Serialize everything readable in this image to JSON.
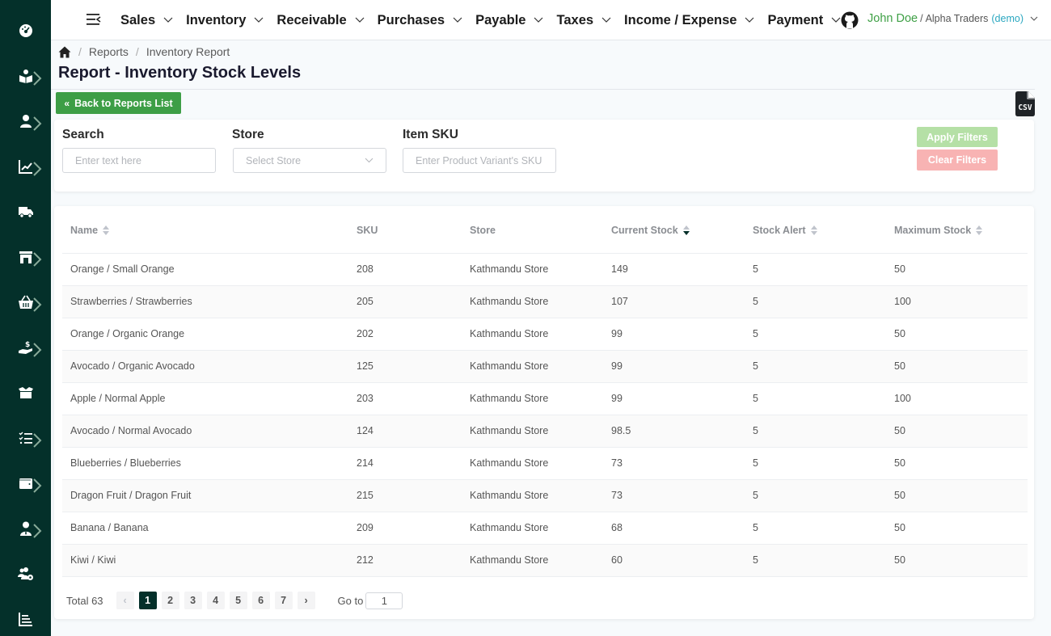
{
  "colors": {
    "sidebar_bg": "#04302a",
    "primary_green": "#3d9e46",
    "apply_disabled": "#b5e0a6",
    "clear_disabled": "#f8b3b3",
    "active_page": "#04302a",
    "user_name": "#3fa046",
    "demo_tag": "#2aa7c0"
  },
  "sidebar": {
    "items": [
      {
        "icon": "dashboard-icon",
        "has_submenu": false
      },
      {
        "icon": "reader-icon",
        "has_submenu": true
      },
      {
        "icon": "user-icon",
        "has_submenu": true
      },
      {
        "icon": "chart-line-icon",
        "has_submenu": true
      },
      {
        "icon": "truck-icon",
        "has_submenu": false
      },
      {
        "icon": "store-icon",
        "has_submenu": true
      },
      {
        "icon": "basket-icon",
        "has_submenu": true
      },
      {
        "icon": "hand-dollar-icon",
        "has_submenu": true
      },
      {
        "icon": "open-box-icon",
        "has_submenu": false
      },
      {
        "icon": "checklist-icon",
        "has_submenu": true
      },
      {
        "icon": "wallet-icon",
        "has_submenu": true
      },
      {
        "icon": "user-tie-icon",
        "has_submenu": true
      },
      {
        "icon": "users-gear-icon",
        "has_submenu": false
      },
      {
        "icon": "bar-chart-icon",
        "has_submenu": false
      }
    ]
  },
  "topbar": {
    "nav": [
      {
        "label": "Sales"
      },
      {
        "label": "Inventory"
      },
      {
        "label": "Receivable"
      },
      {
        "label": "Purchases"
      },
      {
        "label": "Payable"
      },
      {
        "label": "Taxes"
      },
      {
        "label": "Income / Expense"
      },
      {
        "label": "Payment"
      }
    ],
    "user": {
      "name": "John Doe",
      "separator": "/",
      "organization": "Alpha Traders",
      "tag": "(demo)"
    }
  },
  "breadcrumb": {
    "items": [
      "Reports",
      "Inventory Report"
    ],
    "separator": "/"
  },
  "page_title": "Report - Inventory Stock Levels",
  "back_button": {
    "icon": "«",
    "label": "Back to Reports List"
  },
  "csv_label": "CSV",
  "filters": {
    "search": {
      "label": "Search",
      "placeholder": "Enter text here",
      "value": ""
    },
    "store": {
      "label": "Store",
      "placeholder": "Select Store",
      "value": ""
    },
    "item_sku": {
      "label": "Item SKU",
      "placeholder": "Enter Product Variant's SKU",
      "value": ""
    },
    "apply_label": "Apply Filters",
    "clear_label": "Clear Filters"
  },
  "table": {
    "columns": [
      {
        "label": "Name",
        "sortable": true,
        "sort": "none"
      },
      {
        "label": "SKU",
        "sortable": false,
        "sort": "none"
      },
      {
        "label": "Store",
        "sortable": false,
        "sort": "none"
      },
      {
        "label": "Current Stock",
        "sortable": true,
        "sort": "desc"
      },
      {
        "label": "Stock Alert",
        "sortable": true,
        "sort": "none"
      },
      {
        "label": "Maximum Stock",
        "sortable": true,
        "sort": "none"
      }
    ],
    "rows": [
      [
        "Orange / Small Orange",
        "208",
        "Kathmandu Store",
        "149",
        "5",
        "50"
      ],
      [
        "Strawberries / Strawberries",
        "205",
        "Kathmandu Store",
        "107",
        "5",
        "100"
      ],
      [
        "Orange / Organic Orange",
        "202",
        "Kathmandu Store",
        "99",
        "5",
        "50"
      ],
      [
        "Avocado / Organic Avocado",
        "125",
        "Kathmandu Store",
        "99",
        "5",
        "50"
      ],
      [
        "Apple / Normal Apple",
        "203",
        "Kathmandu Store",
        "99",
        "5",
        "100"
      ],
      [
        "Avocado / Normal Avocado",
        "124",
        "Kathmandu Store",
        "98.5",
        "5",
        "50"
      ],
      [
        "Blueberries / Blueberries",
        "214",
        "Kathmandu Store",
        "73",
        "5",
        "50"
      ],
      [
        "Dragon Fruit / Dragon Fruit",
        "215",
        "Kathmandu Store",
        "73",
        "5",
        "50"
      ],
      [
        "Banana / Banana",
        "209",
        "Kathmandu Store",
        "68",
        "5",
        "50"
      ],
      [
        "Kiwi / Kiwi",
        "212",
        "Kathmandu Store",
        "60",
        "5",
        "50"
      ]
    ]
  },
  "pagination": {
    "total_label": "Total 63",
    "pages": [
      "1",
      "2",
      "3",
      "4",
      "5",
      "6",
      "7"
    ],
    "current": "1",
    "prev": "‹",
    "next": "›",
    "goto_label": "Go to",
    "goto_value": "1"
  }
}
